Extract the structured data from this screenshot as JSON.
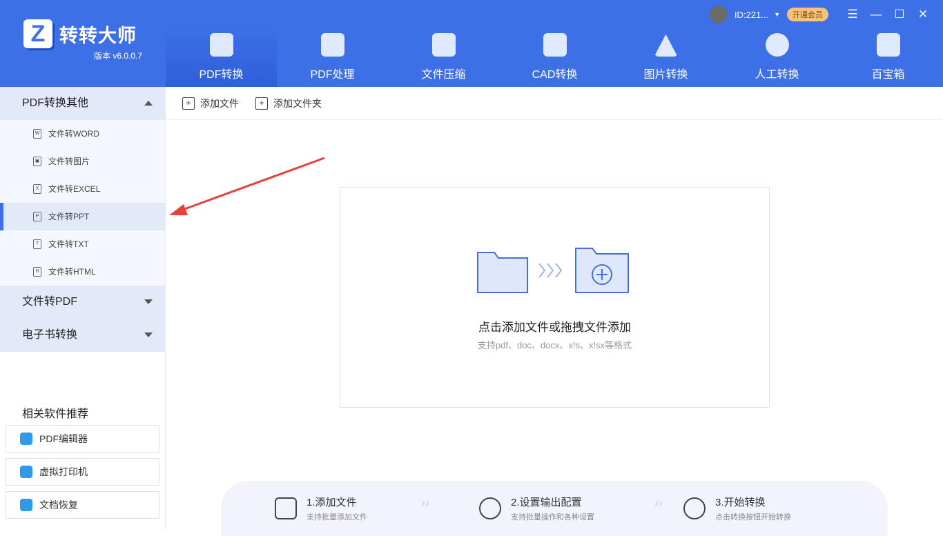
{
  "app": {
    "name": "转转大师",
    "version": "版本 v6.0.0.7",
    "logo_letter": "Z"
  },
  "user": {
    "id": "ID:221...",
    "vip": "开通会员"
  },
  "tabs": [
    {
      "label": "PDF转换"
    },
    {
      "label": "PDF处理"
    },
    {
      "label": "文件压缩"
    },
    {
      "label": "CAD转换"
    },
    {
      "label": "图片转换"
    },
    {
      "label": "人工转换"
    },
    {
      "label": "百宝箱"
    }
  ],
  "sidebar": {
    "sections": [
      {
        "label": "PDF转换其他",
        "items": [
          {
            "label": "文件转WORD",
            "icon": "W"
          },
          {
            "label": "文件转图片",
            "icon": "▣"
          },
          {
            "label": "文件转EXCEL",
            "icon": "X"
          },
          {
            "label": "文件转PPT",
            "icon": "P"
          },
          {
            "label": "文件转TXT",
            "icon": "T"
          },
          {
            "label": "文件转HTML",
            "icon": "H"
          }
        ]
      },
      {
        "label": "文件转PDF"
      },
      {
        "label": "电子书转换"
      }
    ],
    "related_title": "相关软件推荐",
    "related": [
      {
        "label": "PDF编辑器"
      },
      {
        "label": "虚拟打印机"
      },
      {
        "label": "文档恢复"
      }
    ]
  },
  "toolbar": {
    "add_file": "添加文件",
    "add_folder": "添加文件夹"
  },
  "drop": {
    "title": "点击添加文件或拖拽文件添加",
    "subtitle": "支持pdf、doc、docx、x!s、x!sx等格式"
  },
  "steps": [
    {
      "title": "1.添加文件",
      "desc": "支持批量添加文件"
    },
    {
      "title": "2.设置输出配置",
      "desc": "支持批量操作和各种设置"
    },
    {
      "title": "3.开始转换",
      "desc": "点击转换按钮开始转换"
    }
  ],
  "colors": {
    "brand": "#3d6fe6",
    "arrow": "#e8403a"
  }
}
